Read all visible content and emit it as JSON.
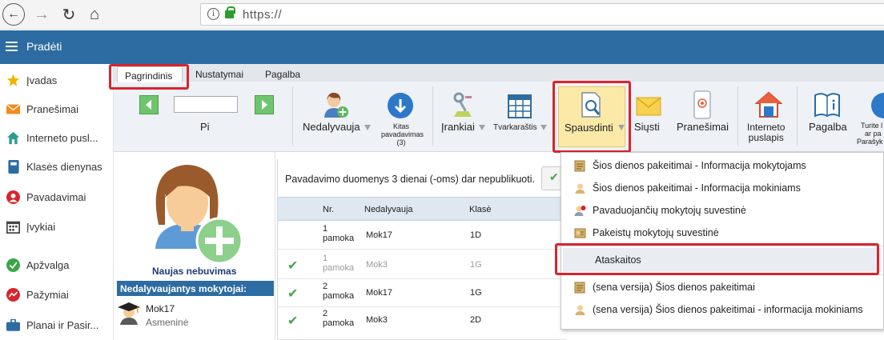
{
  "browser": {
    "url": "https://"
  },
  "app": {
    "title": "Pradėti"
  },
  "sidebar": {
    "items": [
      {
        "label": "Įvadas",
        "icon": "star-icon",
        "color": "#f0b400"
      },
      {
        "label": "Pranešimai",
        "icon": "mail-icon",
        "color": "#f08c1c"
      },
      {
        "label": "Interneto pusl...",
        "icon": "house-icon",
        "color": "#2a9d8f"
      },
      {
        "label": "Klasės dienynas",
        "icon": "book-icon",
        "color": "#2d6ca2"
      },
      {
        "label": "Pavadavimai",
        "icon": "person-icon",
        "color": "#d9242e"
      },
      {
        "label": "Įvykiai",
        "icon": "calendar-icon",
        "color": "#444444"
      },
      {
        "label": "Apžvalga",
        "icon": "check-circle-icon",
        "color": "#3aa64a"
      },
      {
        "label": "Pažymiai",
        "icon": "grade-icon",
        "color": "#d9242e"
      },
      {
        "label": "Planai ir Pasir...",
        "icon": "briefcase-icon",
        "color": "#2d6ca2"
      }
    ]
  },
  "tabs": [
    "Pagrindinis",
    "Nustatymai",
    "Pagalba"
  ],
  "toolbar": {
    "pi_label": "Pi",
    "nedalyvauja": "Nedalyvauja",
    "kitas_line1": "Kitas",
    "kitas_line2": "pavadavimas",
    "kitas_line3": "(3)",
    "irankiai": "Įrankiai",
    "tvarkarastis": "Tvarkaraštis",
    "spausdinti": "Spausdinti",
    "siusti": "Siųsti",
    "pranesimai": "Pranešimai",
    "interneto_line1": "Interneto",
    "interneto_line2": "puslapis",
    "pagalba": "Pagalba",
    "turite_line1": "Turite l",
    "turite_line2": "ar pa",
    "turite_line3": "Parašyk"
  },
  "left_panel": {
    "new_absence": "Naujas nebuvimas",
    "absent_header": "Nedalyvaujantys mokytojai:",
    "teacher_name": "Mok17",
    "teacher_sub": "Asmeninė"
  },
  "notice": "Pavadavimo duomenys 3 dienai (-oms) dar nepublikuoti.",
  "table": {
    "headers": [
      "Nr.",
      "Nedalyvauja",
      "Klasė"
    ],
    "rows": [
      {
        "nr1": "1",
        "nr2": "pamoka",
        "teacher": "Mok17",
        "class": "1D",
        "checked": false,
        "muted": false
      },
      {
        "nr1": "1",
        "nr2": "pamoka",
        "teacher": "Mok3",
        "class": "1G",
        "checked": true,
        "muted": true
      },
      {
        "nr1": "2",
        "nr2": "pamoka",
        "teacher": "Mok17",
        "class": "1G",
        "checked": true,
        "muted": false
      },
      {
        "nr1": "2",
        "nr2": "pamoka",
        "teacher": "Mok3",
        "class": "2D",
        "checked": true,
        "muted": false
      }
    ]
  },
  "menu": {
    "items": [
      "Šios dienos pakeitimai - Informacija mokytojams",
      "Šios dienos pakeitimai - Informacija mokiniams",
      "Pavaduojančių mokytojų suvestinė",
      "Pakeistų mokytojų suvestinė",
      "Ataskaitos",
      "(sena versija) Šios dienos pakeitimai",
      "(sena versija) Šios dienos pakeitimai - informacija mokiniams"
    ]
  }
}
